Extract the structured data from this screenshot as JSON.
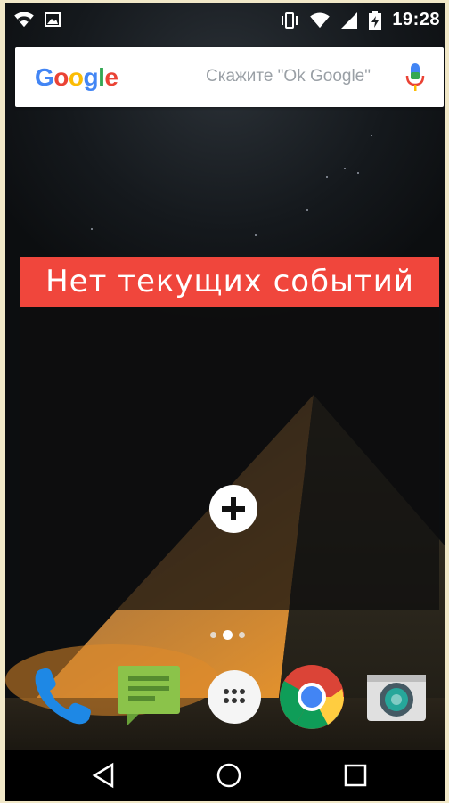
{
  "status_bar": {
    "time": "19:28",
    "left_icons": [
      "wifi-icon",
      "image-notification-icon"
    ],
    "right_icons": [
      "vibrate-icon",
      "wifi-signal-icon",
      "cell-signal-icon",
      "battery-charging-icon"
    ]
  },
  "search": {
    "logo": "Google",
    "hint": "Скажите \"Ok Google\"",
    "mic_icon": "mic-icon"
  },
  "widget": {
    "title": "Нет текущих событий",
    "header_color": "#f0463c",
    "add_icon": "plus-icon"
  },
  "page_indicator": {
    "pages": 3,
    "current": 2
  },
  "dock": {
    "apps": [
      "phone-icon",
      "messages-icon",
      "app-drawer-icon",
      "chrome-icon",
      "camera-icon"
    ]
  },
  "navigation": {
    "buttons": [
      "back-icon",
      "home-icon",
      "recents-icon"
    ]
  }
}
